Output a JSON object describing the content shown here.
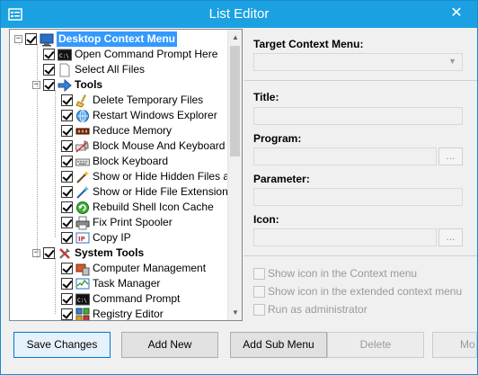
{
  "window": {
    "title": "List Editor",
    "close_glyph": "✕"
  },
  "tree": {
    "items": [
      {
        "label": "Desktop Context Menu",
        "icon": "desktop-icon",
        "level": 0,
        "expander": "−",
        "bold": true,
        "selected": true
      },
      {
        "label": "Open Command Prompt Here",
        "icon": "cmd-icon",
        "level": 1
      },
      {
        "label": "Select All Files",
        "icon": "file-icon",
        "level": 1
      },
      {
        "label": "Tools",
        "icon": "arrow-icon",
        "level": 1,
        "expander": "−",
        "bold": true
      },
      {
        "label": "Delete Temporary Files",
        "icon": "broom-icon",
        "level": 2
      },
      {
        "label": "Restart Windows Explorer",
        "icon": "globe-icon",
        "level": 2
      },
      {
        "label": "Reduce Memory",
        "icon": "memory-icon",
        "level": 2
      },
      {
        "label": "Block Mouse And Keyboard",
        "icon": "keyboard-mouse-icon",
        "level": 2
      },
      {
        "label": "Block Keyboard",
        "icon": "keyboard-icon",
        "level": 2
      },
      {
        "label": "Show or Hide Hidden Files and",
        "icon": "wand-icon",
        "level": 2
      },
      {
        "label": "Show or Hide File Extensions",
        "icon": "wand-blue-icon",
        "level": 2
      },
      {
        "label": "Rebuild Shell Icon Cache",
        "icon": "refresh-icon",
        "level": 2
      },
      {
        "label": "Fix Print Spooler",
        "icon": "printer-icon",
        "level": 2
      },
      {
        "label": "Copy IP",
        "icon": "ip-icon",
        "level": 2
      },
      {
        "label": "System Tools",
        "icon": "tools-icon",
        "level": 1,
        "expander": "−",
        "bold": true
      },
      {
        "label": "Computer Management",
        "icon": "computer-mgmt-icon",
        "level": 2
      },
      {
        "label": "Task Manager",
        "icon": "task-manager-icon",
        "level": 2
      },
      {
        "label": "Command Prompt",
        "icon": "cmd-icon",
        "level": 2
      },
      {
        "label": "Registry Editor",
        "icon": "registry-icon",
        "level": 2
      }
    ]
  },
  "form": {
    "target_label": "Target Context Menu:",
    "title_label": "Title:",
    "program_label": "Program:",
    "parameter_label": "Parameter:",
    "icon_label": "Icon:",
    "browse_glyph": "...",
    "options": [
      "Show icon in the Context menu",
      "Show icon in the extended context menu",
      "Run as administrator"
    ]
  },
  "buttons": {
    "save": "Save Changes",
    "add_new": "Add New",
    "add_sub": "Add Sub Menu",
    "delete": "Delete",
    "more": "Mo"
  },
  "colors": {
    "titlebar": "#1ba1e2",
    "selection": "#3399ff"
  }
}
